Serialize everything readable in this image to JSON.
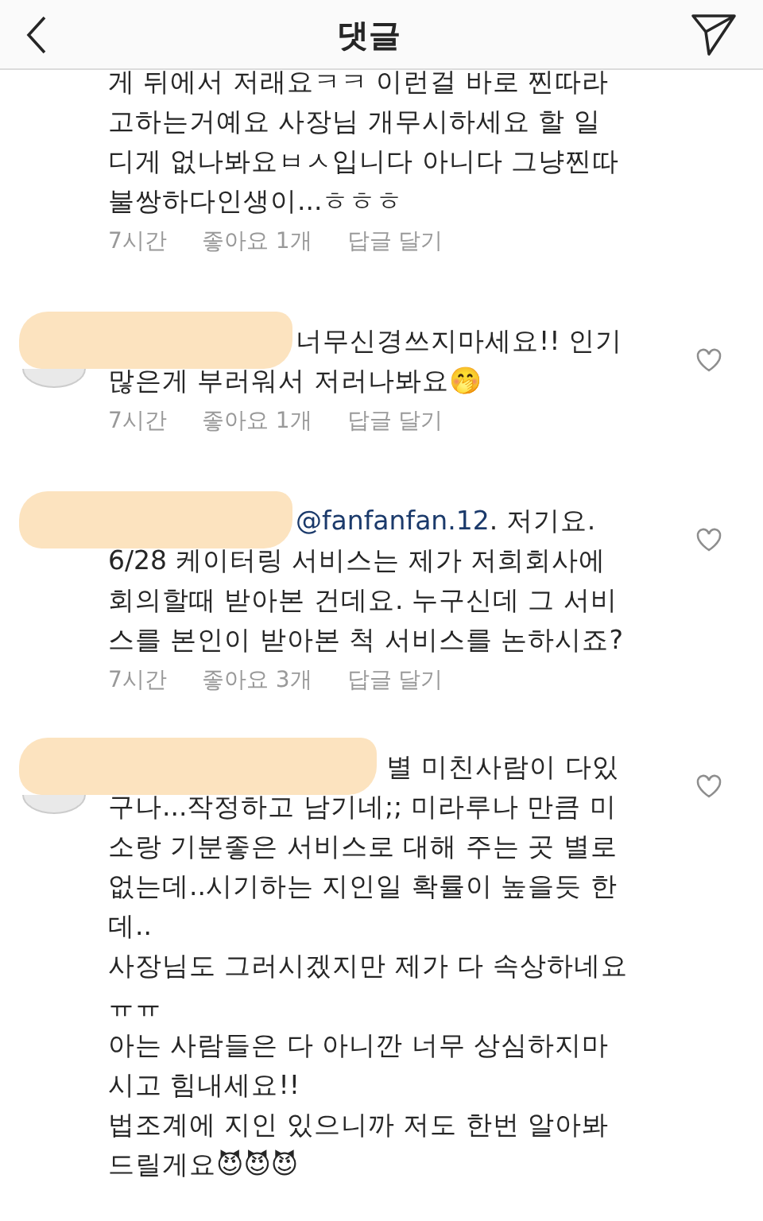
{
  "header": {
    "title": "댓글"
  },
  "comments": [
    {
      "avatar": false,
      "redacted": false,
      "has_like": false,
      "lines": [
        "게 뒤에서 저래요ㅋㅋ 이런걸 바로 찐따라",
        "고하는거예요 사장님 개무시하세요 할 일",
        "디게 없나봐요ㅂㅅ입니다 아니다 그냥찐따",
        "불쌍하다인생이...ㅎㅎㅎ"
      ],
      "time": "7시간",
      "likes": "좋아요 1개",
      "reply": "답글 달기"
    },
    {
      "avatar": true,
      "redacted": true,
      "has_like": true,
      "lines": [
        "너무신경쓰지마세요!! 인기",
        "많은게 부러워서 저러나봐요🤭"
      ],
      "time": "7시간",
      "likes": "좋아요 1개",
      "reply": "답글 달기"
    },
    {
      "avatar": false,
      "redacted": true,
      "has_like": true,
      "mention": "@fanfanfan.12",
      "lines": [
        ". 저기요.",
        "6/28 케이터링 서비스는 제가 저희회사에",
        "회의할때 받아본 건데요. 누구신데 그 서비",
        "스를 본인이 받아본 척 서비스를 논하시죠?"
      ],
      "time": "7시간",
      "likes": "좋아요 3개",
      "reply": "답글 달기"
    },
    {
      "avatar": true,
      "redacted": true,
      "has_like": true,
      "lines": [
        "별 미친사람이 다있",
        "구나...작정하고 남기네;; 미라루나 만큼 미",
        "소랑 기분좋은 서비스로 대해 주는 곳 별로",
        "없는데..시기하는 지인일 확률이 높을듯 한",
        "데..",
        "사장님도 그러시겠지만 제가 다 속상하네요",
        "ㅠㅠ",
        "아는 사람들은 다 아니깐 너무 상심하지마",
        "시고 힘내세요!!",
        "법조계에 지인 있으니까 저도 한번 알아봐",
        "드릴게요😈😈😈"
      ]
    }
  ]
}
